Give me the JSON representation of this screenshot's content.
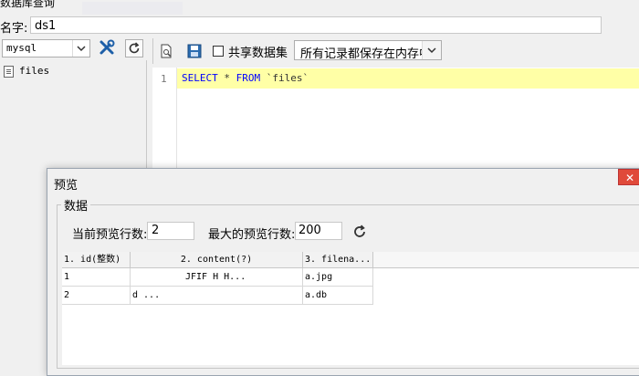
{
  "window": {
    "title": "数据库查询"
  },
  "name_field": {
    "label": "名字:",
    "value": "ds1"
  },
  "datasource": {
    "selected": "mysql"
  },
  "tree": {
    "items": [
      {
        "label": "files"
      }
    ]
  },
  "toolbar": {
    "share_label": "共享数据集",
    "mode_value": "所有记录都保存在内存中"
  },
  "editor": {
    "line_number": "1",
    "sql": {
      "kw_select": "SELECT",
      "star": " * ",
      "kw_from": "FROM",
      "table": " `files`"
    }
  },
  "dialog": {
    "title": "预览",
    "close_glyph": "✕",
    "group_label": "数据",
    "current_rows_label": "当前预览行数:",
    "current_rows_value": "2",
    "max_rows_label": "最大的预览行数:",
    "max_rows_value": "200",
    "table": {
      "columns": [
        "1. id(整数)",
        "2. content(?)",
        "3. filena..."
      ],
      "rows": [
        [
          "1",
          "JFIF          H  H...",
          "a.jpg"
        ],
        [
          "2",
          "d                     ...",
          "a.db"
        ]
      ]
    }
  },
  "icons": {
    "tools": "tools-icon",
    "refresh": "refresh-icon",
    "preview": "preview-icon",
    "save": "save-icon",
    "table": "table-icon"
  },
  "colors": {
    "keyword": "#0000ff",
    "line_highlight": "#ffffa6",
    "close_button": "#e04a3a"
  }
}
